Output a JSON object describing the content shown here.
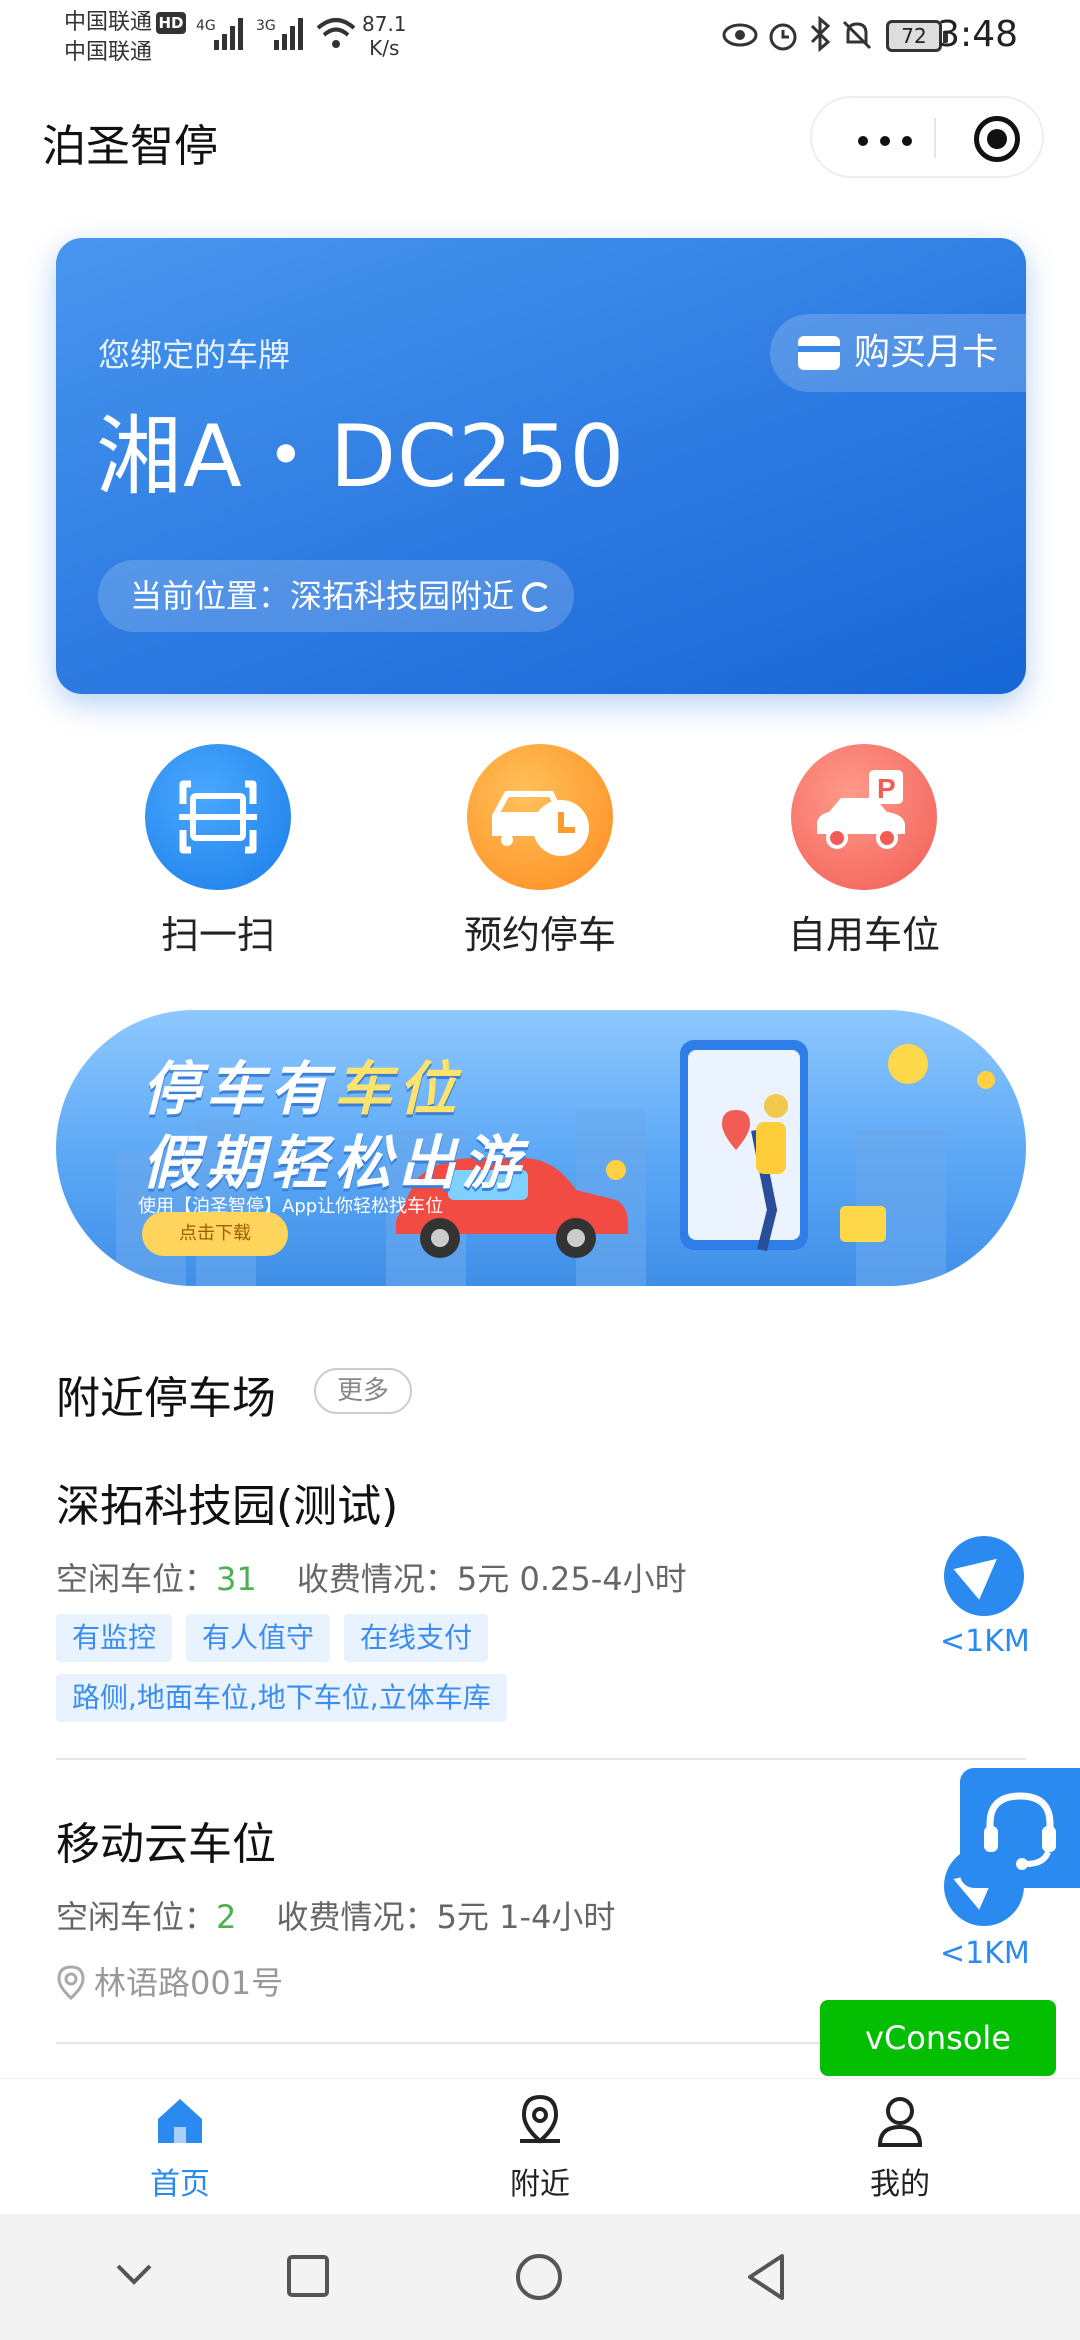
{
  "status_bar": {
    "carrier1": "中国联通",
    "carrier2": "中国联通",
    "hd": "HD",
    "net1": "4G",
    "net2": "3G",
    "speed_value": "87.1",
    "speed_unit": "K/s",
    "battery": "72",
    "time": "3:48"
  },
  "header": {
    "title": "泊圣智停"
  },
  "card": {
    "label": "您绑定的车牌",
    "plate": "湘A・DC250",
    "buy_label": "购买月卡",
    "location_label": "当前位置：深拓科技园附近"
  },
  "quick_actions": [
    {
      "label": "扫一扫"
    },
    {
      "label": "预约停车"
    },
    {
      "label": "自用车位"
    }
  ],
  "banner": {
    "line1_a": "停车有",
    "line1_b": "车位",
    "line2": "假期轻松出游",
    "desc": "使用【泊圣智停】App让你轻松找车位",
    "button": "点击下载"
  },
  "section": {
    "title": "附近停车场",
    "more": "更多"
  },
  "lots": [
    {
      "name": "深拓科技园(测试)",
      "free_label": "空闲车位：",
      "free_count": "31",
      "fee_label": "收费情况：",
      "fee": "5元 0.25-4小时",
      "tags": [
        "有监控",
        "有人值守",
        "在线支付"
      ],
      "type_tag": "路侧,地面车位,地下车位,立体车库",
      "distance": "<1KM"
    },
    {
      "name": "移动云车位",
      "free_label": "空闲车位：",
      "free_count": "2",
      "fee_label": "收费情况：",
      "fee": "5元 1-4小时",
      "address": "林语路001号",
      "distance": "<1KM"
    }
  ],
  "vconsole": "vConsole",
  "tabbar": [
    {
      "label": "首页",
      "active": true
    },
    {
      "label": "附近"
    },
    {
      "label": "我的"
    }
  ],
  "colors": {
    "primary": "#2b8af0",
    "green": "#4caf50",
    "vconsole": "#04be02"
  }
}
